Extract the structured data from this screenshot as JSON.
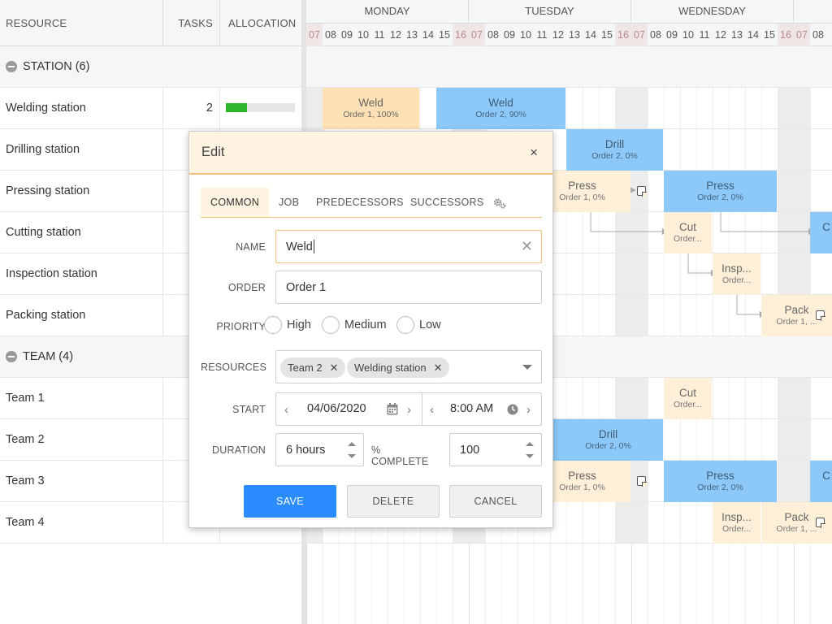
{
  "grid": {
    "headers": {
      "resource": "RESOURCE",
      "tasks": "TASKS",
      "allocation": "ALLOCATION"
    },
    "rows": [
      {
        "name": "STATION (6)",
        "group": true
      },
      {
        "name": "Welding station",
        "tasks": "2",
        "alloc": 0.3
      },
      {
        "name": "Drilling station"
      },
      {
        "name": "Pressing station"
      },
      {
        "name": "Cutting station"
      },
      {
        "name": "Inspection station"
      },
      {
        "name": "Packing station"
      },
      {
        "name": "TEAM (4)",
        "group": true
      },
      {
        "name": "Team 1"
      },
      {
        "name": "Team 2"
      },
      {
        "name": "Team 3"
      },
      {
        "name": "Team 4"
      }
    ]
  },
  "timeline": {
    "days": [
      "MONDAY",
      "TUESDAY",
      "WEDNESDAY"
    ],
    "hours": [
      "07",
      "08",
      "09",
      "10",
      "11",
      "12",
      "13",
      "14",
      "15",
      "16",
      "07",
      "08",
      "09",
      "10",
      "11",
      "12",
      "13",
      "14",
      "15",
      "16",
      "07",
      "08",
      "09",
      "10",
      "11",
      "12",
      "13",
      "14",
      "15",
      "16",
      "07",
      "08"
    ],
    "off_hours": [
      0,
      9,
      10,
      19,
      20,
      29,
      30
    ],
    "tasks": [
      {
        "title": "Weld",
        "sub": "Order 1, 100%",
        "style": "orsel"
      },
      {
        "title": "Weld",
        "sub": "Order 2, 90%",
        "style": "bl"
      },
      {
        "title": "Drill",
        "sub": "Order 2, 0%",
        "style": "bl"
      },
      {
        "title": "Press",
        "sub": "Order 1, 0%",
        "style": "or"
      },
      {
        "title": "Press",
        "sub": "Order 2, 0%",
        "style": "bl"
      },
      {
        "title": "Cut",
        "sub": "Order...",
        "style": "or"
      },
      {
        "title": "C",
        "sub": "",
        "style": "bl"
      },
      {
        "title": "Insp...",
        "sub": "Order...",
        "style": "or"
      },
      {
        "title": "Pack",
        "sub": "Order 1, ...",
        "style": "or"
      },
      {
        "title": "Cut",
        "sub": "Order...",
        "style": "or"
      },
      {
        "title": "Drill",
        "sub": "Order 2, 0%",
        "style": "bl"
      },
      {
        "title": "Press",
        "sub": "Order 1, 0%",
        "style": "or"
      },
      {
        "title": "Press",
        "sub": "Order 2, 0%",
        "style": "bl"
      },
      {
        "title": "C",
        "sub": "",
        "style": "bl"
      },
      {
        "title": "Insp...",
        "sub": "Order...",
        "style": "or"
      },
      {
        "title": "Pack",
        "sub": "Order 1, ...",
        "style": "or"
      }
    ]
  },
  "dialog": {
    "title": "Edit",
    "close": "×",
    "tabs": [
      "COMMON",
      "JOB",
      "PREDECESSORS",
      "SUCCESSORS"
    ],
    "labels": {
      "name": "NAME",
      "order": "ORDER",
      "priority": "PRIORITY",
      "resources": "RESOURCES",
      "start": "START",
      "duration": "DURATION",
      "complete": "% COMPLETE"
    },
    "name_value": "Weld",
    "order_value": "Order 1",
    "priority_options": [
      "High",
      "Medium",
      "Low"
    ],
    "resources": [
      "Team 2",
      "Welding station"
    ],
    "start_date": "04/06/2020",
    "start_time": "8:00 AM",
    "duration_value": "6 hours",
    "complete_value": "100",
    "buttons": {
      "save": "SAVE",
      "delete": "DELETE",
      "cancel": "CANCEL"
    }
  }
}
